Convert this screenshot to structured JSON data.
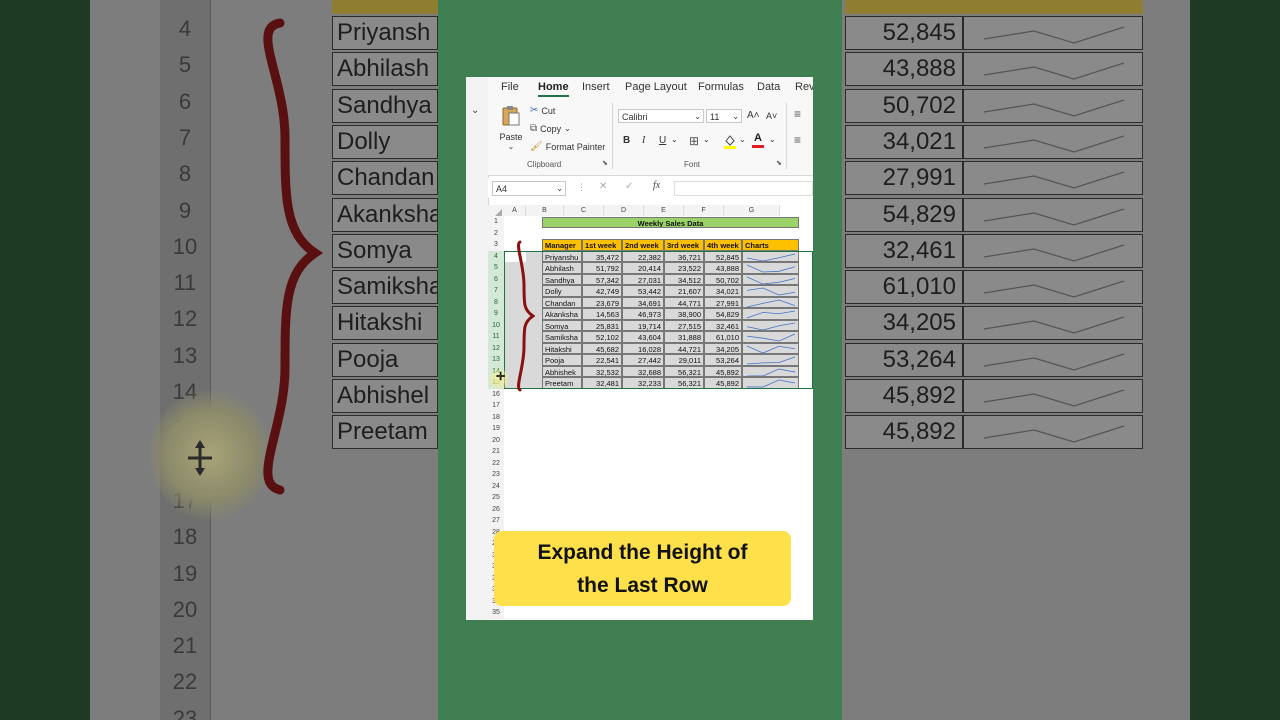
{
  "ribbon": {
    "tabs": [
      "File",
      "Home",
      "Insert",
      "Page Layout",
      "Formulas",
      "Data",
      "Revi"
    ],
    "active_tab": "Home",
    "clipboard": {
      "paste": "Paste",
      "cut": "Cut",
      "copy": "Copy",
      "format_painter": "Format Painter",
      "label": "Clipboard"
    },
    "font": {
      "name": "Calibri",
      "size": "11",
      "label": "Font",
      "bold": "B",
      "italic": "I",
      "underline": "U"
    }
  },
  "formula_bar": {
    "name_box": "A4",
    "fx": "fx"
  },
  "sheet": {
    "columns": [
      "A",
      "B",
      "C",
      "D",
      "E",
      "F",
      "G"
    ],
    "rows": [
      "1",
      "2",
      "3",
      "4",
      "5",
      "6",
      "7",
      "8",
      "9",
      "10",
      "11",
      "12",
      "13",
      "14",
      "15",
      "16",
      "17",
      "18",
      "19",
      "20",
      "21",
      "22",
      "23",
      "24",
      "25",
      "26",
      "27",
      "28",
      "29",
      "30",
      "31",
      "32",
      "33",
      "34",
      "35"
    ],
    "title": "Weekly Sales Data",
    "headers": [
      "Manager",
      "1st week",
      "2nd week",
      "3rd week",
      "4th week",
      "Charts"
    ],
    "data": [
      [
        "Priyanshu",
        "35,472",
        "22,382",
        "36,721",
        "52,845"
      ],
      [
        "Abhilash",
        "51,792",
        "20,414",
        "23,522",
        "43,888"
      ],
      [
        "Sandhya",
        "57,342",
        "27,031",
        "34,512",
        "50,702"
      ],
      [
        "Dolly",
        "42,749",
        "53,442",
        "21,607",
        "34,021"
      ],
      [
        "Chandan",
        "23,679",
        "34,691",
        "44,771",
        "27,991"
      ],
      [
        "Akanksha",
        "14,563",
        "46,973",
        "38,900",
        "54,829"
      ],
      [
        "Somya",
        "25,831",
        "19,714",
        "27,515",
        "32,461"
      ],
      [
        "Samiksha",
        "52,102",
        "43,604",
        "31,888",
        "61,010"
      ],
      [
        "Hitakshi",
        "45,682",
        "16,028",
        "44,721",
        "34,205"
      ],
      [
        "Pooja",
        "22,541",
        "27,442",
        "29,011",
        "53,264"
      ],
      [
        "Abhishek",
        "32,532",
        "32,688",
        "56,321",
        "45,892"
      ],
      [
        "Preetam",
        "32,481",
        "32,233",
        "56,321",
        "45,892"
      ]
    ]
  },
  "background_zoom": {
    "header_left": "Manage",
    "header_right": "4th week",
    "header_charts": "Charts",
    "row_numbers": [
      "4",
      "5",
      "6",
      "7",
      "8",
      "9",
      "10",
      "11",
      "12",
      "13",
      "14",
      "15",
      "16",
      "17",
      "18",
      "19",
      "20",
      "21",
      "22",
      "23"
    ],
    "names": [
      "Priyansh",
      "Abhilash",
      "Sandhya",
      "Dolly",
      "Chandan",
      "Akanksha",
      "Somya",
      "Samiksha",
      "Hitakshi",
      "Pooja",
      "Abhishel",
      "Preetam"
    ],
    "values": [
      "52,845",
      "43,888",
      "50,702",
      "34,021",
      "27,991",
      "54,829",
      "32,461",
      "61,010",
      "34,205",
      "53,264",
      "45,892",
      "45,892"
    ]
  },
  "caption": {
    "line1": "Expand the Height of",
    "line2": "the Last Row"
  },
  "colors": {
    "accent": "#217346",
    "title_fill": "#92d050",
    "header_fill": "#ffc000",
    "caption_bg": "#fde04a",
    "brace": "#8b1010"
  }
}
